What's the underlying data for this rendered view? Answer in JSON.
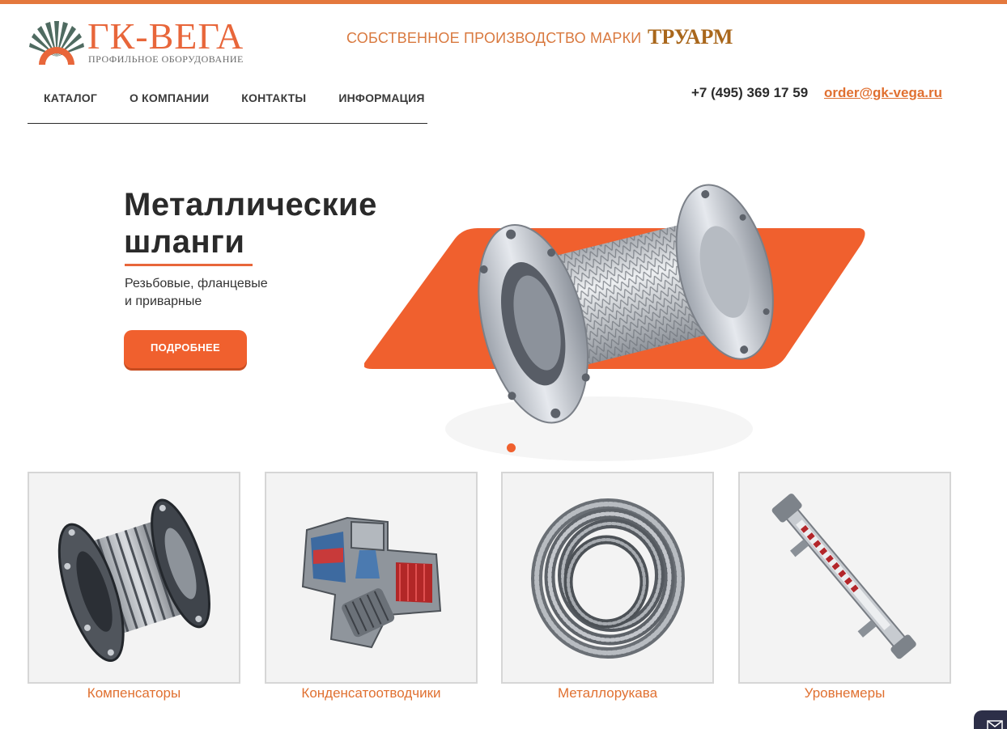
{
  "brand": {
    "title": "ГК-ВЕГА",
    "subtitle": "ПРОФИЛЬНОЕ ОБОРУДОВАНИЕ",
    "accent_color": "#e8663a"
  },
  "header": {
    "own_production_label": "СОБСТВЕННОЕ ПРОИЗВОДСТВО МАРКИ",
    "trade_mark": "ТРУАРМ",
    "phone": "+7 (495) 369 17 59",
    "email": "order@gk-vega.ru"
  },
  "nav": {
    "items": [
      {
        "label": "КАТАЛОГ"
      },
      {
        "label": "О КОМПАНИИ"
      },
      {
        "label": "КОНТАКТЫ"
      },
      {
        "label": "ИНФОРМАЦИЯ"
      }
    ]
  },
  "banner": {
    "title_line1": "Металлические",
    "title_line2": "шланги",
    "sub_line1": "Резьбовые, фланцевые",
    "sub_line2": "и приварные",
    "button_label": "ПОДРОБНЕЕ",
    "slide_index": 1,
    "slide_count": 1
  },
  "categories": [
    {
      "label": "Компенсаторы",
      "icon": "expansion-joint-image"
    },
    {
      "label": "Конденсатоотводчики",
      "icon": "steam-trap-image"
    },
    {
      "label": "Металлорукава",
      "icon": "metal-hose-coil-image"
    },
    {
      "label": "Уровнемеры",
      "icon": "level-gauge-image"
    }
  ],
  "colors": {
    "accent": "#f0602e",
    "link": "#e07030",
    "trademark": "#a9671c"
  }
}
